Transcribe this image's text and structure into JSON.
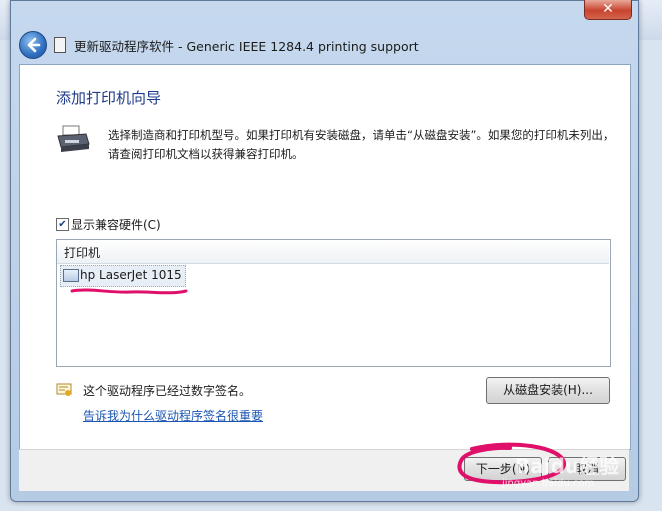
{
  "window": {
    "title": "更新驱动程序软件 - Generic IEEE 1284.4 printing support",
    "close_glyph": "✕"
  },
  "wizard": {
    "heading": "添加打印机向导",
    "description": "选择制造商和打印机型号。如果打印机有安装磁盘，请单击“从磁盘安装”。如果您的打印机未列出，请查阅打印机文档以获得兼容打印机。"
  },
  "compat_checkbox": {
    "label": "显示兼容硬件(C)",
    "checked": true,
    "check_glyph": "✔"
  },
  "printer_list": {
    "column_header": "打印机",
    "items": [
      {
        "label": "hp LaserJet 1015",
        "selected": true
      }
    ]
  },
  "signature": {
    "text": "这个驱动程序已经过数字签名。",
    "link": "告诉我为什么驱动程序签名很重要"
  },
  "buttons": {
    "have_disk": "从磁盘安装(H)...",
    "next": "下一步(N)",
    "cancel": "取消"
  },
  "watermark": {
    "text": "Baidu经验",
    "url": "jingyan.baidu.com"
  },
  "annotation_color": "#e0106a"
}
